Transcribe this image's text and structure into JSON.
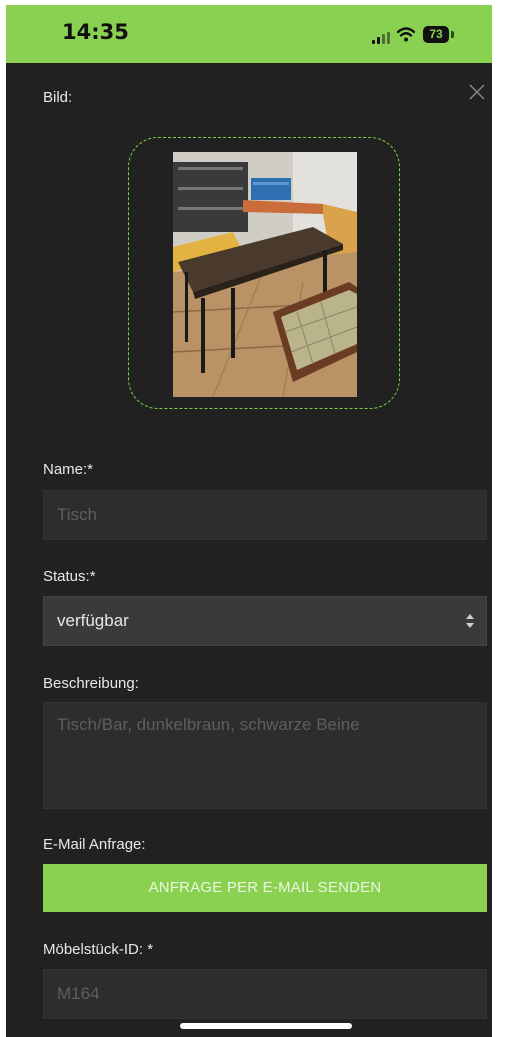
{
  "status_bar": {
    "time": "14:35",
    "battery": "73",
    "signal_icon": "cellular-signal-icon",
    "wifi_icon": "wifi-icon"
  },
  "form": {
    "image_label": "Bild:",
    "close_icon": "close-icon",
    "name_label": "Name:*",
    "name_placeholder": "Tisch",
    "status_label": "Status:*",
    "status_value": "verfügbar",
    "description_label": "Beschreibung:",
    "description_placeholder": "Tisch/Bar, dunkelbraun, schwarze Beine",
    "email_label": "E-Mail Anfrage:",
    "email_button": "ANFRAGE PER E-MAIL SENDEN",
    "id_label": "Möbelstück-ID: *",
    "id_placeholder": "M164"
  },
  "colors": {
    "accent": "#8bd151",
    "background": "#212121",
    "field": "#2d2d2d"
  }
}
